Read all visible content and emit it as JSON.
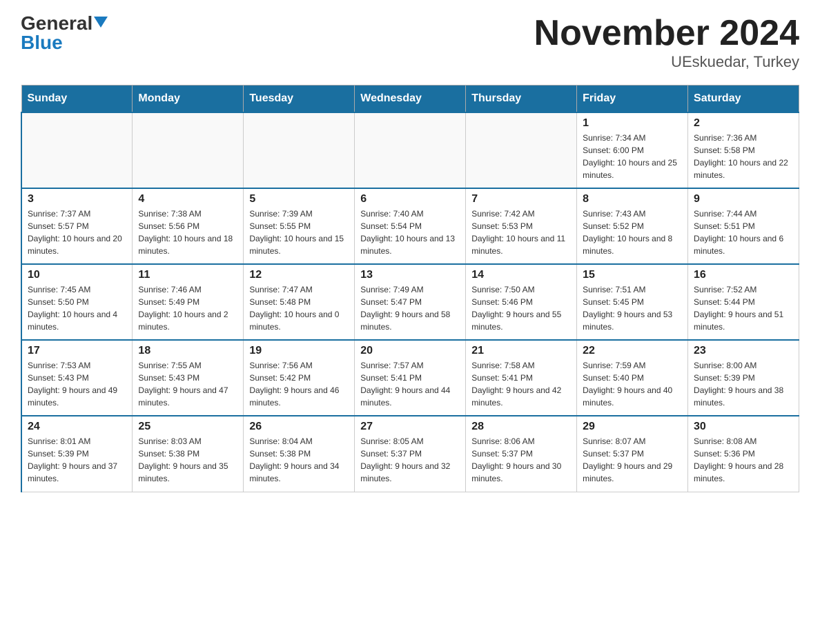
{
  "header": {
    "logo_general": "General",
    "logo_blue": "Blue",
    "month_title": "November 2024",
    "location": "UEskuedar, Turkey"
  },
  "weekdays": [
    "Sunday",
    "Monday",
    "Tuesday",
    "Wednesday",
    "Thursday",
    "Friday",
    "Saturday"
  ],
  "weeks": [
    [
      {
        "day": "",
        "info": ""
      },
      {
        "day": "",
        "info": ""
      },
      {
        "day": "",
        "info": ""
      },
      {
        "day": "",
        "info": ""
      },
      {
        "day": "",
        "info": ""
      },
      {
        "day": "1",
        "info": "Sunrise: 7:34 AM\nSunset: 6:00 PM\nDaylight: 10 hours and 25 minutes."
      },
      {
        "day": "2",
        "info": "Sunrise: 7:36 AM\nSunset: 5:58 PM\nDaylight: 10 hours and 22 minutes."
      }
    ],
    [
      {
        "day": "3",
        "info": "Sunrise: 7:37 AM\nSunset: 5:57 PM\nDaylight: 10 hours and 20 minutes."
      },
      {
        "day": "4",
        "info": "Sunrise: 7:38 AM\nSunset: 5:56 PM\nDaylight: 10 hours and 18 minutes."
      },
      {
        "day": "5",
        "info": "Sunrise: 7:39 AM\nSunset: 5:55 PM\nDaylight: 10 hours and 15 minutes."
      },
      {
        "day": "6",
        "info": "Sunrise: 7:40 AM\nSunset: 5:54 PM\nDaylight: 10 hours and 13 minutes."
      },
      {
        "day": "7",
        "info": "Sunrise: 7:42 AM\nSunset: 5:53 PM\nDaylight: 10 hours and 11 minutes."
      },
      {
        "day": "8",
        "info": "Sunrise: 7:43 AM\nSunset: 5:52 PM\nDaylight: 10 hours and 8 minutes."
      },
      {
        "day": "9",
        "info": "Sunrise: 7:44 AM\nSunset: 5:51 PM\nDaylight: 10 hours and 6 minutes."
      }
    ],
    [
      {
        "day": "10",
        "info": "Sunrise: 7:45 AM\nSunset: 5:50 PM\nDaylight: 10 hours and 4 minutes."
      },
      {
        "day": "11",
        "info": "Sunrise: 7:46 AM\nSunset: 5:49 PM\nDaylight: 10 hours and 2 minutes."
      },
      {
        "day": "12",
        "info": "Sunrise: 7:47 AM\nSunset: 5:48 PM\nDaylight: 10 hours and 0 minutes."
      },
      {
        "day": "13",
        "info": "Sunrise: 7:49 AM\nSunset: 5:47 PM\nDaylight: 9 hours and 58 minutes."
      },
      {
        "day": "14",
        "info": "Sunrise: 7:50 AM\nSunset: 5:46 PM\nDaylight: 9 hours and 55 minutes."
      },
      {
        "day": "15",
        "info": "Sunrise: 7:51 AM\nSunset: 5:45 PM\nDaylight: 9 hours and 53 minutes."
      },
      {
        "day": "16",
        "info": "Sunrise: 7:52 AM\nSunset: 5:44 PM\nDaylight: 9 hours and 51 minutes."
      }
    ],
    [
      {
        "day": "17",
        "info": "Sunrise: 7:53 AM\nSunset: 5:43 PM\nDaylight: 9 hours and 49 minutes."
      },
      {
        "day": "18",
        "info": "Sunrise: 7:55 AM\nSunset: 5:43 PM\nDaylight: 9 hours and 47 minutes."
      },
      {
        "day": "19",
        "info": "Sunrise: 7:56 AM\nSunset: 5:42 PM\nDaylight: 9 hours and 46 minutes."
      },
      {
        "day": "20",
        "info": "Sunrise: 7:57 AM\nSunset: 5:41 PM\nDaylight: 9 hours and 44 minutes."
      },
      {
        "day": "21",
        "info": "Sunrise: 7:58 AM\nSunset: 5:41 PM\nDaylight: 9 hours and 42 minutes."
      },
      {
        "day": "22",
        "info": "Sunrise: 7:59 AM\nSunset: 5:40 PM\nDaylight: 9 hours and 40 minutes."
      },
      {
        "day": "23",
        "info": "Sunrise: 8:00 AM\nSunset: 5:39 PM\nDaylight: 9 hours and 38 minutes."
      }
    ],
    [
      {
        "day": "24",
        "info": "Sunrise: 8:01 AM\nSunset: 5:39 PM\nDaylight: 9 hours and 37 minutes."
      },
      {
        "day": "25",
        "info": "Sunrise: 8:03 AM\nSunset: 5:38 PM\nDaylight: 9 hours and 35 minutes."
      },
      {
        "day": "26",
        "info": "Sunrise: 8:04 AM\nSunset: 5:38 PM\nDaylight: 9 hours and 34 minutes."
      },
      {
        "day": "27",
        "info": "Sunrise: 8:05 AM\nSunset: 5:37 PM\nDaylight: 9 hours and 32 minutes."
      },
      {
        "day": "28",
        "info": "Sunrise: 8:06 AM\nSunset: 5:37 PM\nDaylight: 9 hours and 30 minutes."
      },
      {
        "day": "29",
        "info": "Sunrise: 8:07 AM\nSunset: 5:37 PM\nDaylight: 9 hours and 29 minutes."
      },
      {
        "day": "30",
        "info": "Sunrise: 8:08 AM\nSunset: 5:36 PM\nDaylight: 9 hours and 28 minutes."
      }
    ]
  ]
}
